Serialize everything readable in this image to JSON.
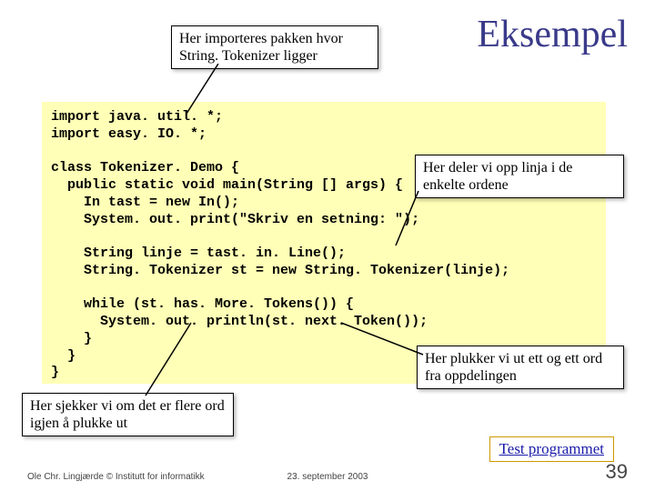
{
  "title": "Eksempel",
  "callouts": {
    "top": "Her importeres pakken hvor String. Tokenizer ligger",
    "right1": "Her deler vi opp linja i de enkelte ordene",
    "right2": "Her plukker vi ut ett og ett ord fra oppdelingen",
    "left": "Her sjekker vi om det er flere ord igjen å plukke ut"
  },
  "code": "import java. util. *;\nimport easy. IO. *;\n\nclass Tokenizer. Demo {\n  public static void main(String [] args) {\n    In tast = new In();\n    System. out. print(\"Skriv en setning: \");\n\n    String linje = tast. in. Line();\n    String. Tokenizer st = new String. Tokenizer(linje);\n\n    while (st. has. More. Tokens()) {\n      System. out. println(st. next. Token());\n    }\n  }\n}",
  "testlink": "Test programmet",
  "footer": {
    "left": "Ole Chr. Lingjærde © Institutt for informatikk",
    "center": "23. september 2003",
    "right": "39"
  }
}
